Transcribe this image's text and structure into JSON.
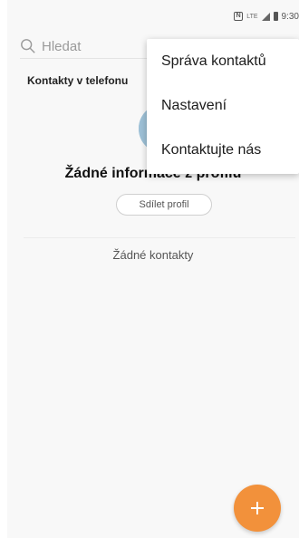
{
  "status_bar": {
    "time": "9:30",
    "network": "LTE"
  },
  "search": {
    "placeholder": "Hledat"
  },
  "section": {
    "label": "Kontakty v telefonu"
  },
  "profile": {
    "title": "Žádné informace z profilu",
    "share_label": "Sdílet profil"
  },
  "contacts": {
    "empty_text": "Žádné kontakty"
  },
  "menu": {
    "items": [
      {
        "label": "Správa kontaktů"
      },
      {
        "label": "Nastavení"
      },
      {
        "label": "Kontaktujte nás"
      }
    ]
  },
  "colors": {
    "fab": "#f2913b",
    "avatar_bg": "#9ec1d7"
  },
  "icons": {
    "search": "search-icon",
    "add": "plus-icon"
  }
}
